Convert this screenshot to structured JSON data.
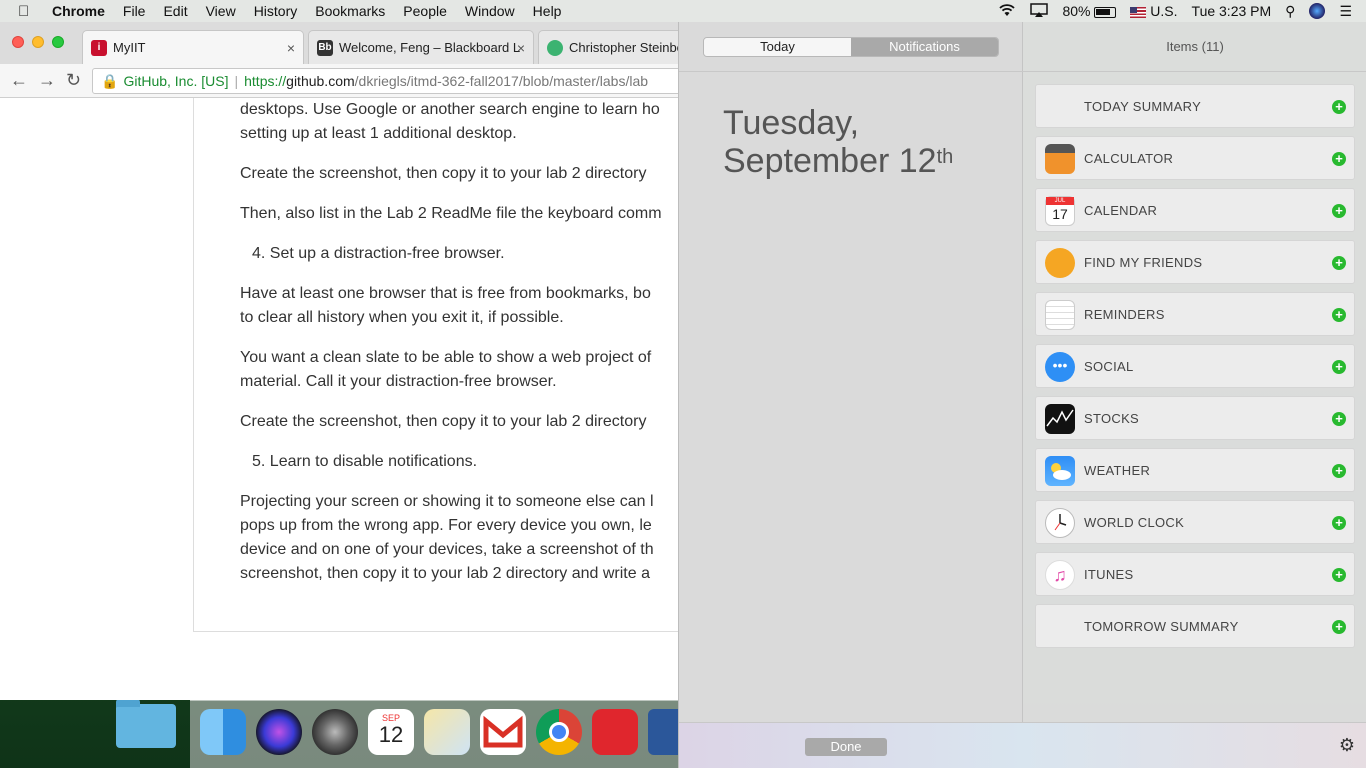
{
  "menubar": {
    "app": "Chrome",
    "items": [
      "File",
      "Edit",
      "View",
      "History",
      "Bookmarks",
      "People",
      "Window",
      "Help"
    ],
    "battery": "80%",
    "input_source": "U.S.",
    "clock": "Tue 3:23 PM"
  },
  "browser": {
    "tabs": [
      {
        "title": "MyIIT"
      },
      {
        "title": "Welcome, Feng – Blackboard L"
      },
      {
        "title": "Christopher Steinbe"
      }
    ],
    "omnibox": {
      "org": "GitHub, Inc. [US]",
      "scheme": "https://",
      "host": "github.com",
      "path": "/dkriegls/itmd-362-fall2017/blob/master/labs/lab"
    },
    "paragraphs": [
      "desktops. Use Google or another search engine to learn ho",
      "setting up at least 1 additional desktop.",
      "Create the screenshot, then copy it to your lab 2 directory",
      "Then, also list in the Lab 2 ReadMe file the keyboard comm",
      "4. Set up a distraction-free browser.",
      "Have at least one browser that is free from bookmarks, bo",
      "to clear all history when you exit it, if possible.",
      "You want a clean slate to be able to show a web project of",
      "material. Call it your distraction-free browser.",
      "Create the screenshot, then copy it to your lab 2 directory",
      "5. Learn to disable notifications.",
      "Projecting your screen or showing it to someone else can l",
      "pops up from the wrong app. For every device you own, le",
      "device and on one of your devices, take a screenshot of th",
      "screenshot, then copy it to your lab 2 directory and write a"
    ]
  },
  "dock": {
    "calendar_month": "SEP",
    "calendar_day": "12"
  },
  "notification_center": {
    "segments": {
      "today": "Today",
      "notifications": "Notifications"
    },
    "date_line1": "Tuesday,",
    "date_line2": "September 12",
    "date_suffix": "th",
    "items_title": "Items (11)",
    "widgets": [
      {
        "label": "TODAY SUMMARY",
        "icon": "none"
      },
      {
        "label": "CALCULATOR",
        "icon": "calculator-icon"
      },
      {
        "label": "CALENDAR",
        "icon": "calendar-icon"
      },
      {
        "label": "FIND MY FRIENDS",
        "icon": "find-my-friends-icon"
      },
      {
        "label": "REMINDERS",
        "icon": "reminders-icon"
      },
      {
        "label": "SOCIAL",
        "icon": "social-icon"
      },
      {
        "label": "STOCKS",
        "icon": "stocks-icon"
      },
      {
        "label": "WEATHER",
        "icon": "weather-icon"
      },
      {
        "label": "WORLD CLOCK",
        "icon": "world-clock-icon"
      },
      {
        "label": "ITUNES",
        "icon": "itunes-icon"
      },
      {
        "label": "TOMORROW SUMMARY",
        "icon": "none"
      }
    ],
    "calendar_widget": {
      "month": "JUL",
      "day": "17"
    },
    "done": "Done"
  }
}
